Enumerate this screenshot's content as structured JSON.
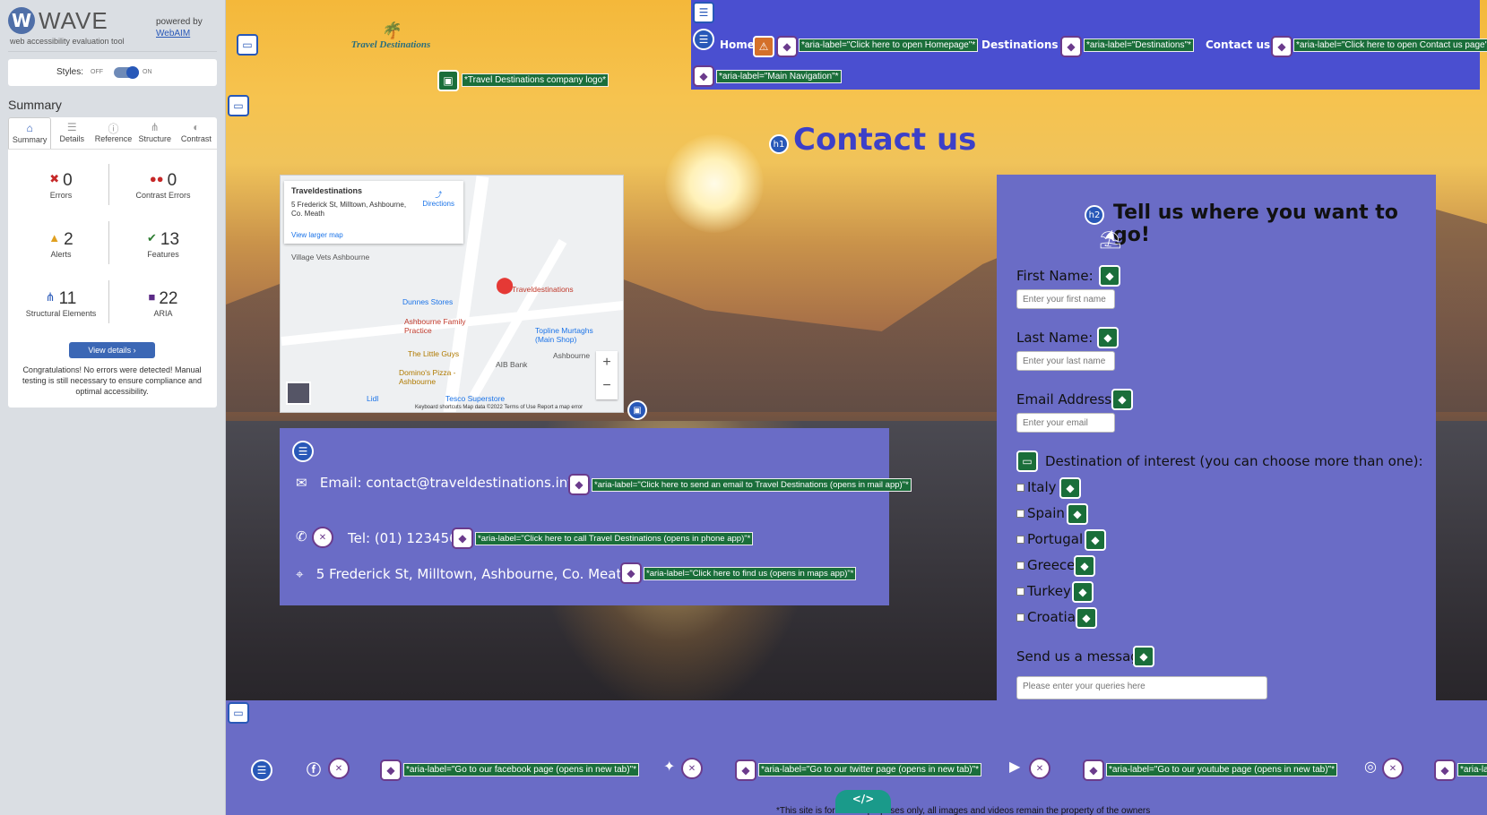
{
  "wave": {
    "name": "WAVE",
    "subtitle": "web accessibility evaluation tool",
    "powered_by": "powered by",
    "webaim": "WebAIM",
    "styles_label": "Styles:",
    "off": "OFF",
    "on": "ON",
    "summary_title": "Summary",
    "tabs": [
      {
        "label": "Summary",
        "icon": "home-icon"
      },
      {
        "label": "Details",
        "icon": "list-icon"
      },
      {
        "label": "Reference",
        "icon": "info-icon"
      },
      {
        "label": "Structure",
        "icon": "structure-icon"
      },
      {
        "label": "Contrast",
        "icon": "contrast-icon"
      }
    ],
    "stats": [
      {
        "value": "0",
        "label": "Errors",
        "color": "#c62828"
      },
      {
        "value": "0",
        "label": "Contrast Errors",
        "color": "#c62828"
      },
      {
        "value": "2",
        "label": "Alerts",
        "color": "#e0a020"
      },
      {
        "value": "13",
        "label": "Features",
        "color": "#2e7d32"
      },
      {
        "value": "11",
        "label": "Structural Elements",
        "color": "#2858b8"
      },
      {
        "value": "22",
        "label": "ARIA",
        "color": "#5b2a86"
      }
    ],
    "view_details": "View details ›",
    "message": "Congratulations! No errors were detected! Manual testing is still necessary to ensure compliance and optimal accessibility."
  },
  "site": {
    "logo_text": "Travel Destinations",
    "logo_alt": "*Travel Destinations company logo*",
    "nav": [
      {
        "label": "Home",
        "aria": "*aria-label=\"Click here to open Homepage\"*"
      },
      {
        "label": "Destinations",
        "aria": "*aria-label=\"Destinations\"*"
      },
      {
        "label": "Contact us",
        "aria": "*aria-label=\"Click here to open Contact us page\"*"
      }
    ],
    "nav_aria": "*aria-label=\"Main Navigation\"*",
    "heading": "Contact us",
    "map": {
      "place": "Traveldestinations",
      "address": "5 Frederick St, Milltown, Ashbourne, Co. Meath",
      "directions": "Directions",
      "larger": "View larger map",
      "labels": [
        "Village Vets Ashbourne",
        "Dunnes Stores",
        "Ashbourne Family Practice",
        "The Little Guys",
        "Domino's Pizza - Ashbourne",
        "AIB Bank",
        "Topline Murtaghs (Main Shop)",
        "Lidl",
        "Tesco Superstore",
        "Traveldestinations",
        "Ashbourne"
      ],
      "footer": "Keyboard shortcuts   Map data ©2022   Terms of Use   Report a map error"
    },
    "contact": {
      "email": "Email: contact@traveldestinations.info",
      "email_aria": "*aria-label=\"Click here to send an email to Travel Destinations (opens in mail app)\"*",
      "tel": "Tel: (01) 1234567",
      "tel_aria": "*aria-label=\"Click here to call Travel Destinations (opens in phone app)\"*",
      "address": "5 Frederick St, Milltown, Ashbourne, Co. Meath",
      "address_aria": "*aria-label=\"Click here to find us (opens in maps app)\"*"
    },
    "form": {
      "heading": "Tell us where you want to go!",
      "first_label": "First Name:",
      "first_ph": "Enter your first name",
      "last_label": "Last Name:",
      "last_ph": "Enter your last name",
      "email_label": "Email Address:",
      "email_ph": "Enter your email",
      "dest_label": "Destination of interest (you can choose more than one):",
      "destinations": [
        "Italy",
        "Spain",
        "Portugal",
        "Greece",
        "Turkey",
        "Croatia"
      ],
      "msg_label": "Send us a message:",
      "msg_ph": "Please enter your queries here"
    },
    "footer": {
      "facebook_aria": "*aria-label=\"Go to our facebook page (opens in new tab)\"*",
      "twitter_aria": "*aria-label=\"Go to our twitter page (opens in new tab)\"*",
      "youtube_aria": "*aria-label=\"Go to our youtube page (opens in new tab)\"*",
      "instagram_aria": "*aria-la",
      "note": "*This site is for",
      "note_tail": "purposes only, all images and videos remain the property of the owners",
      "code": "</>"
    }
  }
}
